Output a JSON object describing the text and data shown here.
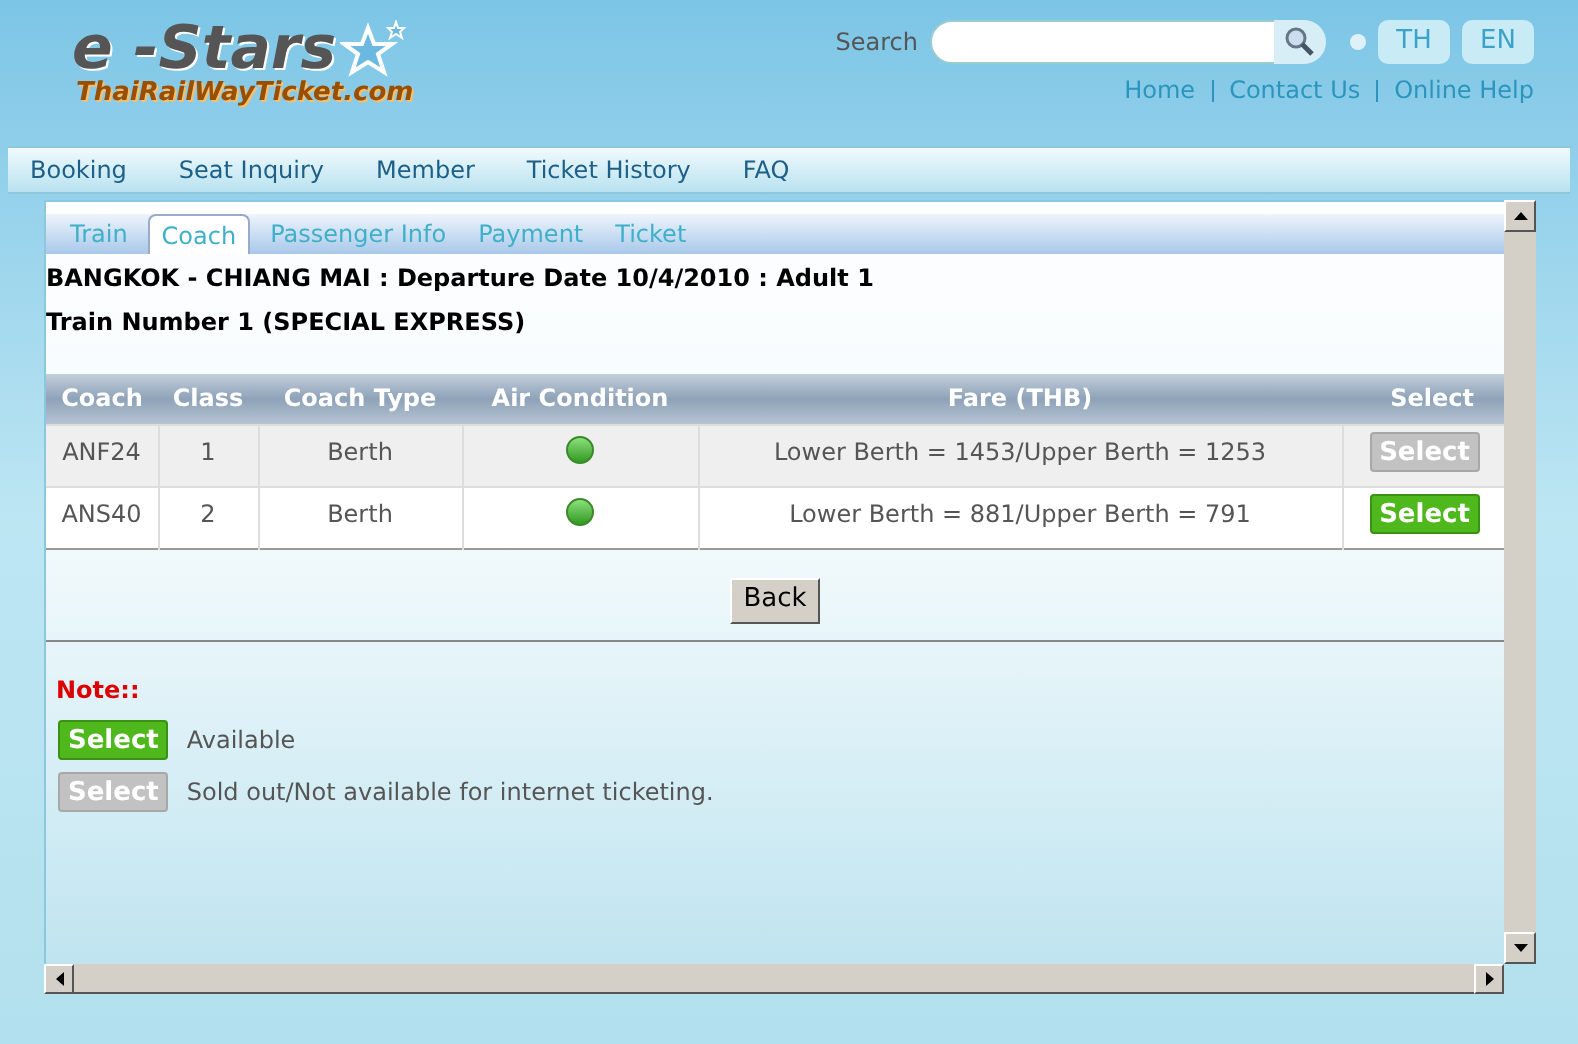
{
  "logo": {
    "title": "e -Stars",
    "subtitle": "ThaiRailWayTicket.com"
  },
  "search": {
    "label": "Search"
  },
  "languages": [
    {
      "label": "TH",
      "selected": false
    },
    {
      "label": "EN",
      "selected": false
    }
  ],
  "top_links": [
    "Home",
    "Contact Us",
    "Online Help"
  ],
  "nav": [
    "Booking",
    "Seat Inquiry",
    "Member",
    "Ticket History",
    "FAQ"
  ],
  "steps": [
    {
      "label": "Train",
      "selected": false
    },
    {
      "label": "Coach",
      "selected": true
    },
    {
      "label": "Passenger Info",
      "selected": false
    },
    {
      "label": "Payment",
      "selected": false
    },
    {
      "label": "Ticket",
      "selected": false
    }
  ],
  "journey": "BANGKOK - CHIANG MAI : Departure Date 10/4/2010 : Adult 1",
  "train": "Train Number 1 (SPECIAL EXPRESS)",
  "table": {
    "columns": [
      "Coach",
      "Class",
      "Coach Type",
      "Air Condition",
      "Fare (THB)",
      "Select"
    ],
    "rows": [
      {
        "coach": "ANF24",
        "class": "1",
        "type": "Berth",
        "air_condition": true,
        "fare": "Lower Berth = 1453/Upper Berth = 1253",
        "button": "Select",
        "available": false
      },
      {
        "coach": "ANS40",
        "class": "2",
        "type": "Berth",
        "air_condition": true,
        "fare": "Lower Berth = 881/Upper Berth = 791",
        "button": "Select",
        "available": true
      }
    ]
  },
  "back_button": "Back",
  "note": {
    "title": "Note::",
    "items": [
      {
        "button": "Select",
        "available": true,
        "text": "Available"
      },
      {
        "button": "Select",
        "available": false,
        "text": "Sold out/Not available for internet ticketing."
      }
    ]
  }
}
